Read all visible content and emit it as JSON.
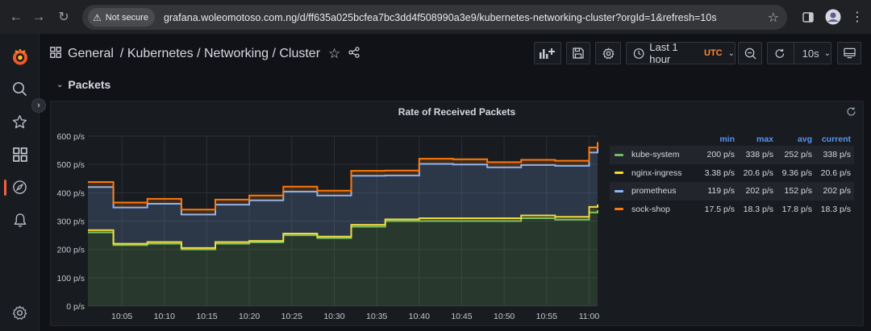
{
  "browser": {
    "security_label": "Not secure",
    "url": "grafana.woleomotoso.com.ng/d/ff635a025bcfea7bc3dd4f508990a3e9/kubernetes-networking-cluster?orgId=1&refresh=10s"
  },
  "breadcrumb": {
    "root": "General",
    "path": "/ Kubernetes / Networking / Cluster"
  },
  "toolbar": {
    "time_range": "Last 1 hour",
    "timezone": "UTC",
    "refresh_interval": "10s"
  },
  "row": {
    "title": "Packets"
  },
  "panel": {
    "title": "Rate of Received Packets"
  },
  "legend": {
    "headers": {
      "min": "min",
      "max": "max",
      "avg": "avg",
      "current": "current"
    },
    "rows": [
      {
        "name": "kube-system",
        "color": "#73bf69",
        "min": "200 p/s",
        "max": "338 p/s",
        "avg": "252 p/s",
        "current": "338 p/s"
      },
      {
        "name": "nginx-ingress",
        "color": "#fade2a",
        "min": "3.38 p/s",
        "max": "20.6 p/s",
        "avg": "9.36 p/s",
        "current": "20.6 p/s"
      },
      {
        "name": "prometheus",
        "color": "#8ab8ff",
        "min": "119 p/s",
        "max": "202 p/s",
        "avg": "152 p/s",
        "current": "202 p/s"
      },
      {
        "name": "sock-shop",
        "color": "#ff780a",
        "min": "17.5 p/s",
        "max": "18.3 p/s",
        "avg": "17.8 p/s",
        "current": "18.3 p/s"
      }
    ]
  },
  "colors": {
    "grafana_orange": "#f55f3e",
    "legend_header": "#5794f2",
    "background": "#111217",
    "panel": "#181b1f"
  },
  "chart_data": {
    "type": "area",
    "stacked": true,
    "y_unit": "p/s",
    "ylim": [
      0,
      600
    ],
    "y_ticks": [
      0,
      100,
      200,
      300,
      400,
      500,
      600
    ],
    "y_tick_labels": [
      "0 p/s",
      "100 p/s",
      "200 p/s",
      "300 p/s",
      "400 p/s",
      "500 p/s",
      "600 p/s"
    ],
    "x_range": [
      "10:01",
      "11:01"
    ],
    "x_ticks": [
      "10:05",
      "10:10",
      "10:15",
      "10:20",
      "10:25",
      "10:30",
      "10:35",
      "10:40",
      "10:45",
      "10:50",
      "10:55",
      "11:00"
    ],
    "x": [
      "10:01",
      "10:04",
      "10:08",
      "10:12",
      "10:16",
      "10:20",
      "10:24",
      "10:28",
      "10:32",
      "10:36",
      "10:40",
      "10:44",
      "10:48",
      "10:52",
      "10:56",
      "11:00",
      "11:01"
    ],
    "series": [
      {
        "name": "kube-system",
        "values": [
          260,
          215,
          220,
          200,
          220,
          225,
          250,
          240,
          280,
          300,
          300,
          300,
          300,
          310,
          305,
          330,
          338
        ]
      },
      {
        "name": "nginx-ingress",
        "values": [
          8,
          5,
          6,
          5,
          6,
          5,
          6,
          5,
          7,
          6,
          10,
          10,
          10,
          10,
          10,
          20,
          20.6
        ]
      },
      {
        "name": "prometheus",
        "values": [
          152,
          128,
          135,
          118,
          132,
          143,
          148,
          145,
          173,
          155,
          192,
          190,
          180,
          178,
          180,
          192,
          202
        ]
      },
      {
        "name": "sock-shop",
        "values": [
          18,
          17.5,
          17.5,
          17.5,
          17.5,
          17.5,
          17.5,
          17.5,
          17.5,
          17.5,
          18,
          18,
          18,
          18,
          18,
          18,
          18.3
        ]
      }
    ]
  }
}
